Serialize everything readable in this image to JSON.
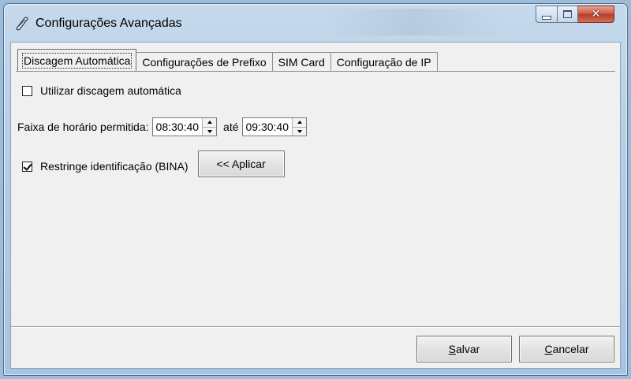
{
  "window": {
    "title": "Configurações Avançadas",
    "minimize_label": "minimize",
    "maximize_label": "maximize",
    "close_label": "close"
  },
  "tabs": [
    {
      "label": "Discagem Automática",
      "active": true
    },
    {
      "label": "Configurações de Prefixo",
      "active": false
    },
    {
      "label": "SIM Card",
      "active": false
    },
    {
      "label": "Configuração de IP",
      "active": false
    }
  ],
  "auto_dial": {
    "checkbox_label": "Utilizar discagem automática",
    "checked": false
  },
  "time_range": {
    "label": "Faixa de horário permitida:",
    "start": "08:30:40",
    "separator": "até",
    "end": "09:30:40"
  },
  "bina": {
    "checkbox_label": "Restringe identificação (BINA)",
    "checked": true,
    "apply_button": "<< Aplicar"
  },
  "footer": {
    "save_first": "S",
    "save_rest": "alvar",
    "cancel_first": "C",
    "cancel_rest": "ancelar"
  }
}
